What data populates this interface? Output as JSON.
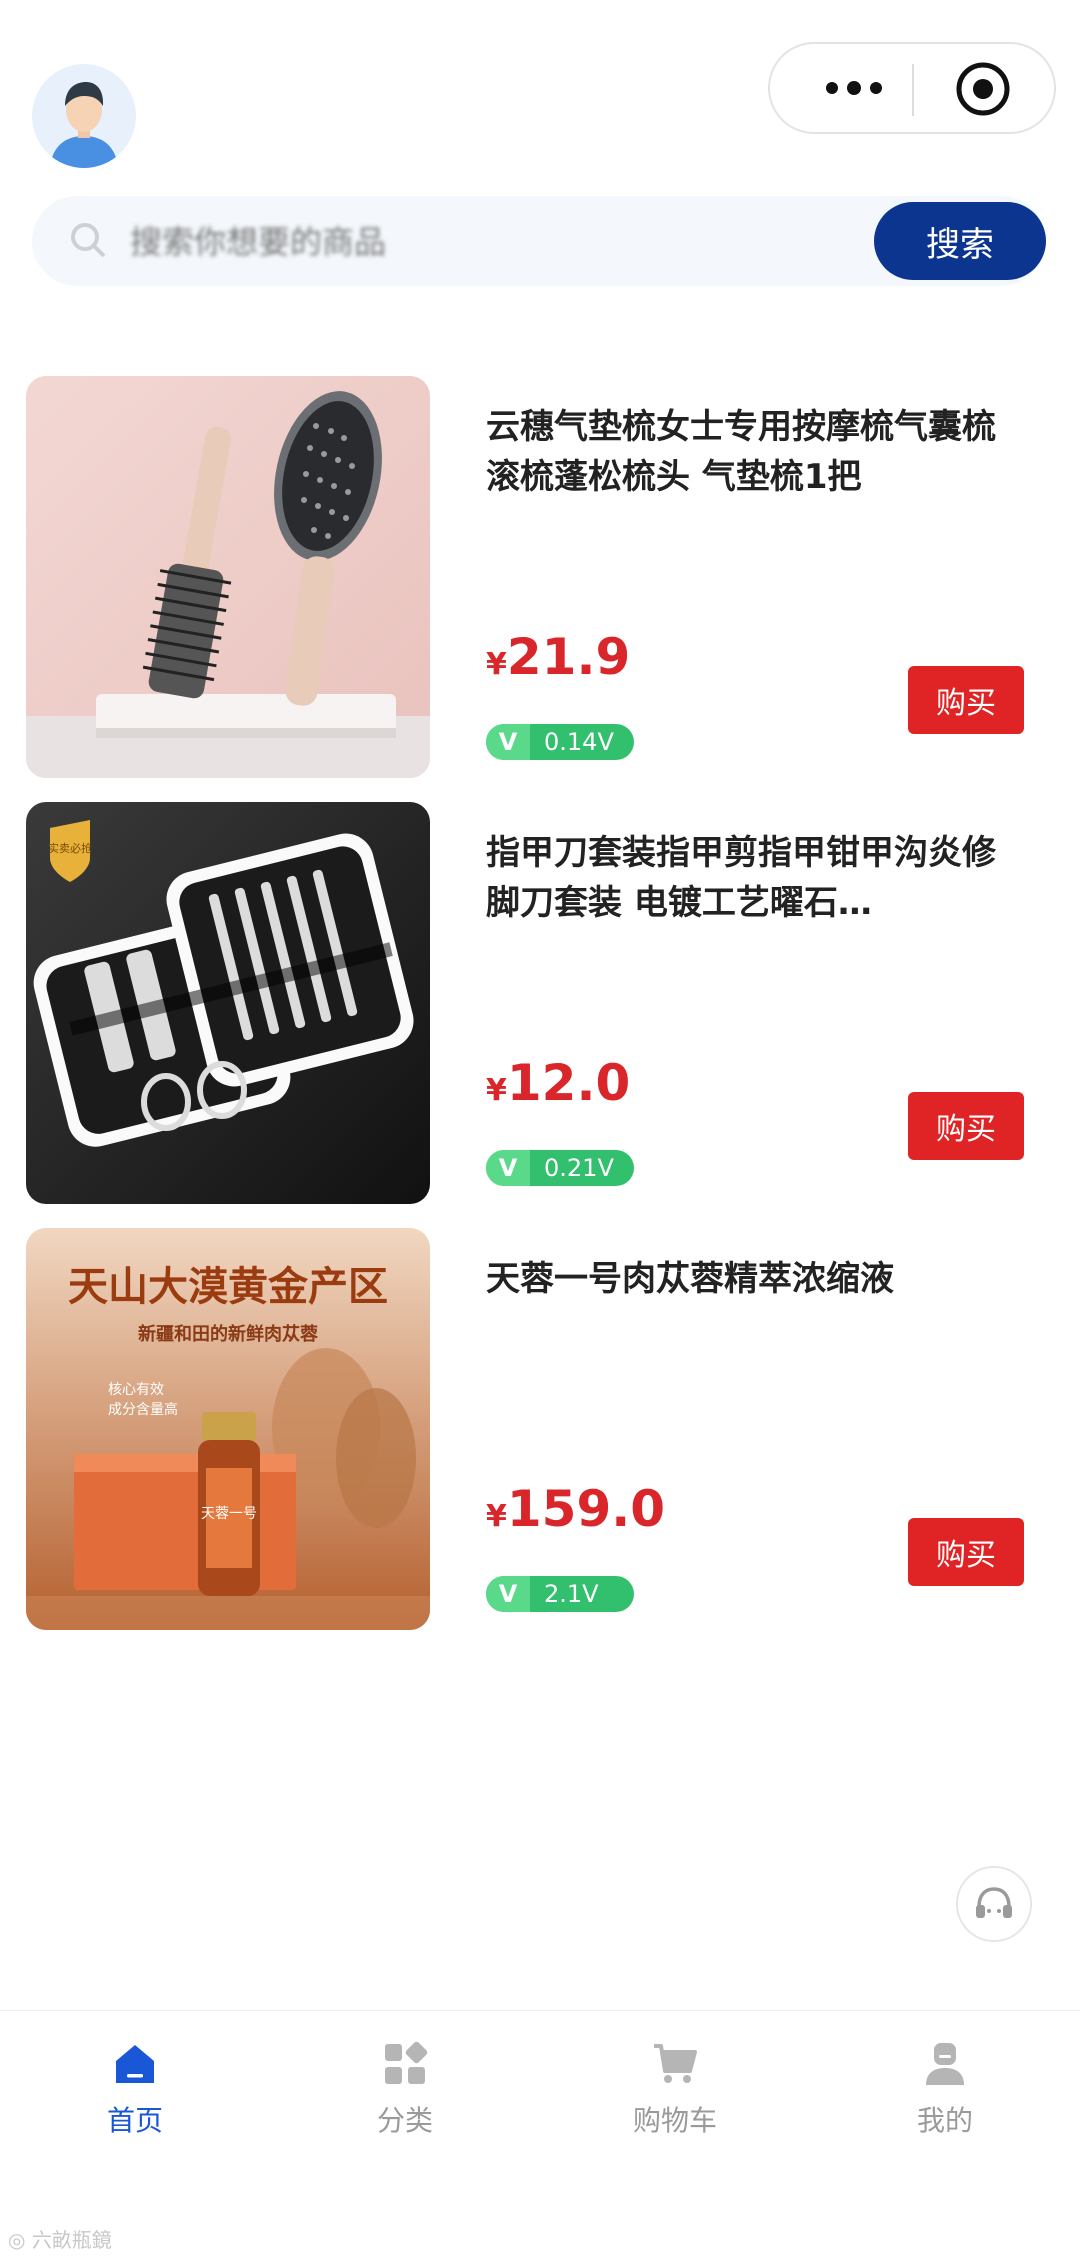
{
  "header": {
    "avatar_icon": "user-avatar-icon",
    "capsule": {
      "more_icon": "more-dots-icon",
      "close_icon": "target-circle-icon"
    }
  },
  "search": {
    "placeholder": "搜索你想要的商品",
    "button_label": "搜索",
    "icon": "search-icon",
    "button_color": "#0c3590"
  },
  "products": [
    {
      "title": "云穗气垫梳女士专用按摩梳气囊梳滚梳蓬松梳头 气垫梳1把",
      "currency": "¥",
      "price": "21.9",
      "v_label": "V",
      "v_value": "0.14V",
      "buy_label": "购买"
    },
    {
      "title": "指甲刀套装指甲剪指甲钳甲沟炎修脚刀套装 电镀工艺曜石…",
      "currency": "¥",
      "price": "12.0",
      "v_label": "V",
      "v_value": "0.21V",
      "buy_label": "购买",
      "image_badge": "实卖必抢"
    },
    {
      "title": "天蓉一号肉苁蓉精萃浓缩液",
      "currency": "¥",
      "price": "159.0",
      "v_label": "V",
      "v_value": "2.1V",
      "buy_label": "购买",
      "image_text": {
        "headline": "天山大漠黄金产区",
        "sub": "新疆和田的新鲜肉苁蓉",
        "bullet1": "核心有效",
        "bullet2": "成分含量高",
        "bottle_label": "天蓉一号"
      }
    }
  ],
  "service": {
    "icon": "headset-icon"
  },
  "tabbar": {
    "tabs": [
      {
        "label": "首页",
        "icon": "home-icon",
        "active": true
      },
      {
        "label": "分类",
        "icon": "category-icon",
        "active": false
      },
      {
        "label": "购物车",
        "icon": "cart-icon",
        "active": false
      },
      {
        "label": "我的",
        "icon": "profile-icon",
        "active": false
      }
    ],
    "active_color": "#1a57d6",
    "inactive_color": "#9a9a9a"
  },
  "watermark": "六畝瓶鏡",
  "colors": {
    "price": "#d9262b",
    "buy": "#e02324",
    "v_badge": "#32c06e"
  }
}
